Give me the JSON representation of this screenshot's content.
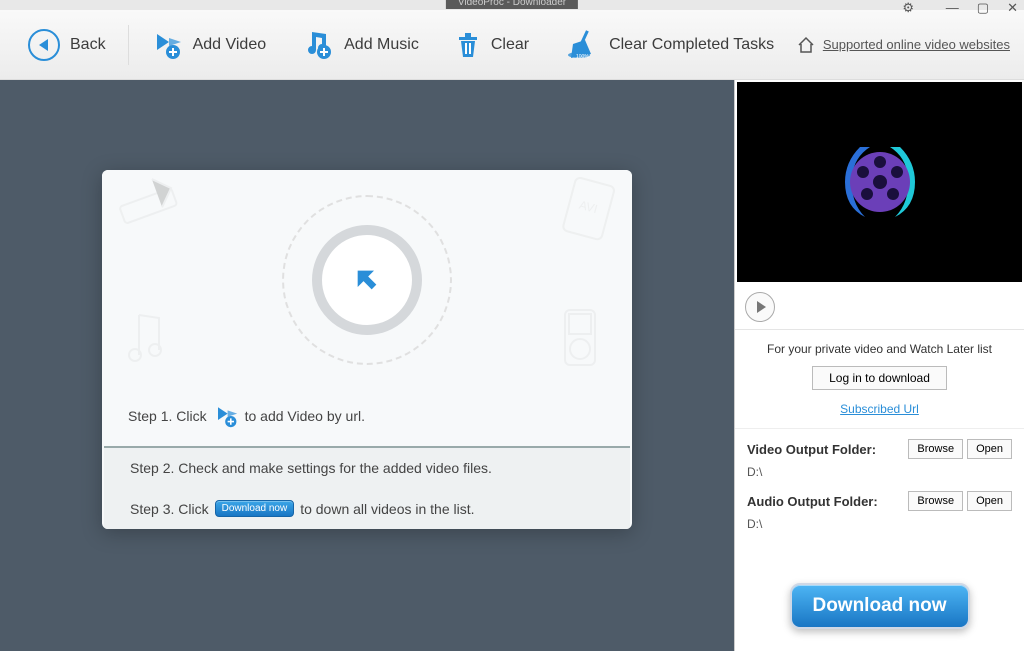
{
  "titlebar": {
    "title": "VideoProc - Downloader"
  },
  "toolbar": {
    "back": "Back",
    "add_video": "Add Video",
    "add_music": "Add Music",
    "clear": "Clear",
    "clear_completed": "Clear Completed Tasks",
    "supported_link": "Supported online video websites"
  },
  "steps": {
    "s1_a": "Step 1. Click",
    "s1_b": "to add Video by url.",
    "s2": "Step 2. Check and make settings for the added video files.",
    "s3_a": "Step 3. Click",
    "s3_btn": "Download now",
    "s3_b": "to down all videos in the list."
  },
  "right": {
    "login_msg": "For your private video and Watch Later list",
    "login_btn": "Log in to download",
    "subscribed": "Subscribed Url",
    "video_folder_label": "Video Output Folder:",
    "video_folder_path": "D:\\",
    "audio_folder_label": "Audio Output Folder:",
    "audio_folder_path": "D:\\",
    "browse": "Browse",
    "open": "Open",
    "download_btn": "Download now"
  },
  "colors": {
    "accent": "#2a8ed8"
  }
}
